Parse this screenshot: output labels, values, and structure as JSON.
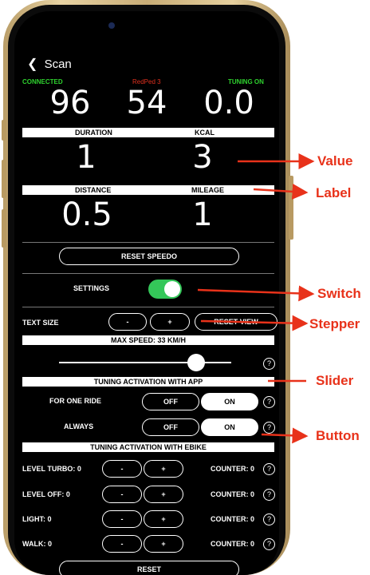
{
  "nav": {
    "back_label": "Scan"
  },
  "status": {
    "connected": "CONNECTED",
    "device": "RedPed 3",
    "tuning": "TUNING ON"
  },
  "metrics_top": {
    "v1": "96",
    "v2": "54",
    "v3": "0.0"
  },
  "duration": {
    "label": "DURATION",
    "value": "1"
  },
  "kcal": {
    "label": "KCAL",
    "value": "3"
  },
  "distance": {
    "label": "DISTANCE",
    "value": "0.5"
  },
  "mileage": {
    "label": "MILEAGE",
    "value": "1"
  },
  "reset_speedo": "RESET SPEEDO",
  "settings": {
    "label": "SETTINGS",
    "on": true
  },
  "text_size": {
    "label": "TEXT SIZE",
    "minus": "-",
    "plus": "+",
    "reset_view": "RESET VIEW"
  },
  "max_speed": {
    "label": "MAX SPEED: 33 KM/H",
    "level": 0.83
  },
  "tuning_app": {
    "title": "TUNING ACTIVATION WITH APP",
    "rows": [
      {
        "label": "FOR ONE RIDE",
        "off": "OFF",
        "on": "ON"
      },
      {
        "label": "ALWAYS",
        "off": "OFF",
        "on": "ON"
      }
    ]
  },
  "tuning_ebike": {
    "title": "TUNING ACTIVATION WITH EBIKE",
    "rows": [
      {
        "label": "LEVEL TURBO: 0",
        "minus": "-",
        "plus": "+",
        "counter": "COUNTER: 0"
      },
      {
        "label": "LEVEL OFF: 0",
        "minus": "-",
        "plus": "+",
        "counter": "COUNTER: 0"
      },
      {
        "label": "LIGHT: 0",
        "minus": "-",
        "plus": "+",
        "counter": "COUNTER: 0"
      },
      {
        "label": "WALK: 0",
        "minus": "-",
        "plus": "+",
        "counter": "COUNTER: 0"
      }
    ]
  },
  "reset_bottom": "RESET",
  "help_glyph": "?",
  "annotations": {
    "value": "Value",
    "label": "Label",
    "switch": "Switch",
    "stepper": "Stepper",
    "slider": "Slider",
    "button": "Button"
  },
  "colors": {
    "connected": "#2ed12e",
    "device": "#e0301e",
    "switch_on": "#34c759",
    "annotation": "#e8321a"
  }
}
